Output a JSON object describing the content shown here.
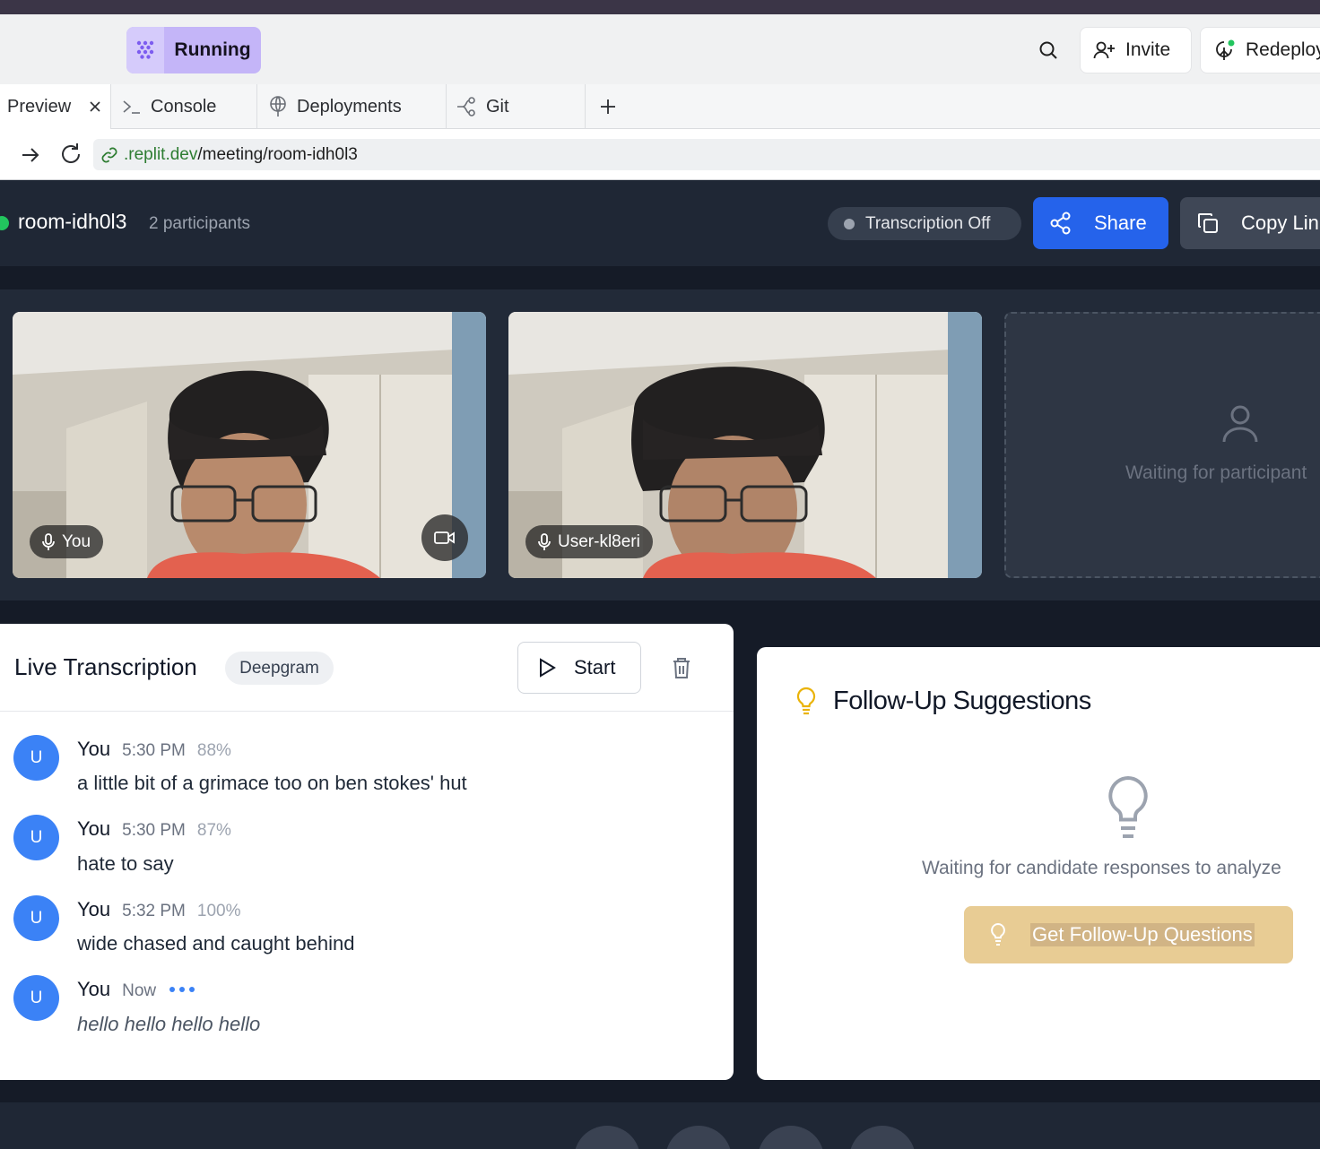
{
  "workspace": {
    "run_label": "Running",
    "invite_label": "Invite",
    "redeploy_label": "Redeploy"
  },
  "tabs": [
    {
      "label": "Preview",
      "active": true
    },
    {
      "label": "Console"
    },
    {
      "label": "Deployments"
    },
    {
      "label": "Git"
    }
  ],
  "url": {
    "host": ".replit.dev",
    "path": "/meeting/room-idh0l3"
  },
  "meeting": {
    "room_name": "room-idh0l3",
    "participant_count": "2 participants",
    "transcription_status": "Transcription Off",
    "share_label": "Share",
    "copy_label": "Copy Link"
  },
  "videos": [
    {
      "name": "You"
    },
    {
      "name": "User-kl8eri"
    }
  ],
  "waiting_tile": {
    "text": "Waiting for participant"
  },
  "transcript": {
    "title": "Live Transcription",
    "provider": "Deepgram",
    "start_label": "Start",
    "messages": [
      {
        "avatar": "U",
        "name": "You",
        "time": "5:30 PM",
        "confidence": "88%",
        "text": "a little bit of a grimace too on ben stokes' hut"
      },
      {
        "avatar": "U",
        "name": "You",
        "time": "5:30 PM",
        "confidence": "87%",
        "text": "hate to say"
      },
      {
        "avatar": "U",
        "name": "You",
        "time": "5:32 PM",
        "confidence": "100%",
        "text": "wide chased and caught behind"
      },
      {
        "avatar": "U",
        "name": "You",
        "time": "Now",
        "confidence": "",
        "text": "hello hello hello hello",
        "interim": true
      }
    ]
  },
  "followup": {
    "title": "Follow-Up Suggestions",
    "waiting_text": "Waiting for candidate responses to analyze",
    "button_label": "Get Follow-Up Questions"
  },
  "colors": {
    "accent": "#2563eb",
    "running": "#c4b5f8",
    "live": "#22c55e",
    "avatar": "#3b82f6",
    "followup_button": "#e8cc94",
    "bulb": "#eab308"
  }
}
